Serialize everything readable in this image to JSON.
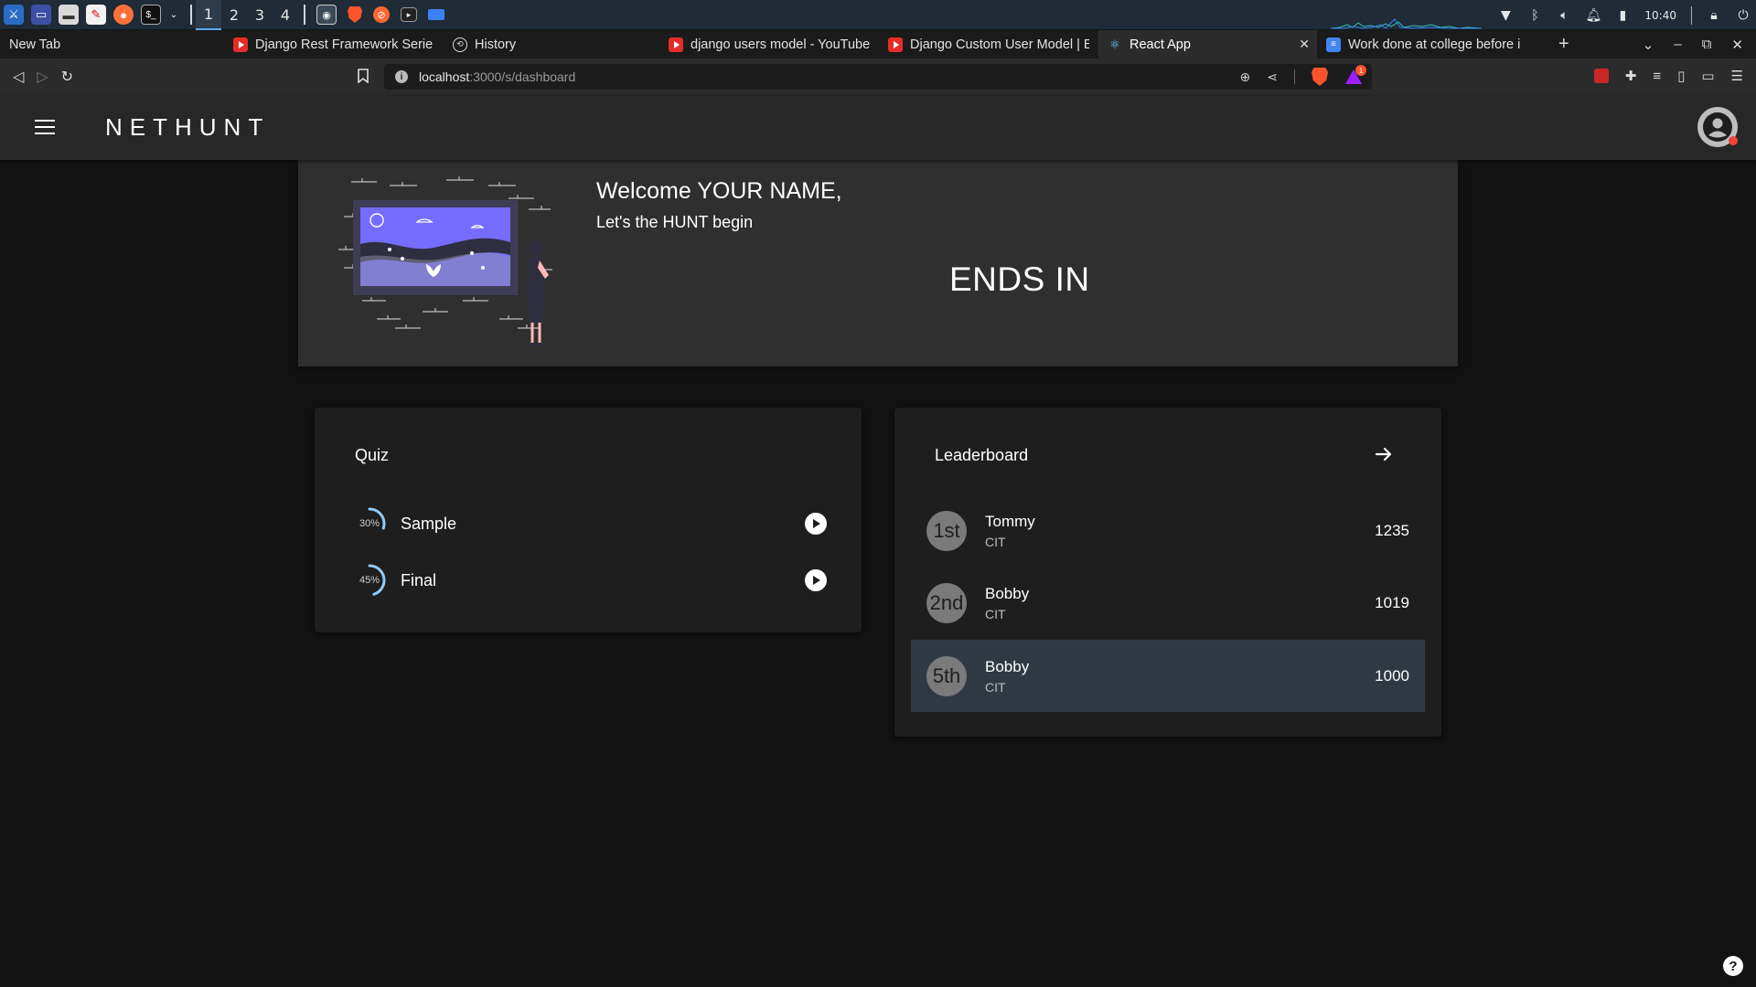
{
  "os": {
    "workspaces": [
      "1",
      "2",
      "3",
      "4"
    ],
    "active_workspace": "1",
    "clock": "10:40"
  },
  "browser": {
    "tabs": [
      {
        "label": "New Tab",
        "icon": "none"
      },
      {
        "label": "Django Rest Framework Serie",
        "icon": "youtube-icon"
      },
      {
        "label": "History",
        "icon": "history-icon"
      },
      {
        "label": "django users model - YouTube",
        "icon": "youtube-icon"
      },
      {
        "label": "Django Custom User Model | E",
        "icon": "youtube-icon"
      },
      {
        "label": "React App",
        "icon": "react-icon",
        "active": true
      },
      {
        "label": "Work done at college before i",
        "icon": "docs-icon"
      }
    ],
    "url_host": "localhost",
    "url_path": ":3000/s/dashboard",
    "rewards_count": "1"
  },
  "app": {
    "brand": "NETHUNT"
  },
  "welcome": {
    "title": "Welcome YOUR NAME,",
    "subtitle": "Let's the HUNT begin",
    "countdown_label": "ENDS IN"
  },
  "quiz": {
    "title": "Quiz",
    "items": [
      {
        "name": "Sample",
        "progress_label": "30%",
        "progress": 30
      },
      {
        "name": "Final",
        "progress_label": "45%",
        "progress": 45
      }
    ]
  },
  "leaderboard": {
    "title": "Leaderboard",
    "rows": [
      {
        "rank": "1st",
        "name": "Tommy",
        "org": "CIT",
        "score": "1235"
      },
      {
        "rank": "2nd",
        "name": "Bobby",
        "org": "CIT",
        "score": "1019"
      },
      {
        "rank": "5th",
        "name": "Bobby",
        "org": "CIT",
        "score": "1000",
        "highlight": true
      }
    ]
  },
  "colors": {
    "app_bg": "#121212",
    "card_bg": "#1e1e1e",
    "appbar_bg": "#272727",
    "accent_progress": "#90caf9",
    "illustration_purple": "#6c63ff",
    "highlight_row": "#303942"
  }
}
